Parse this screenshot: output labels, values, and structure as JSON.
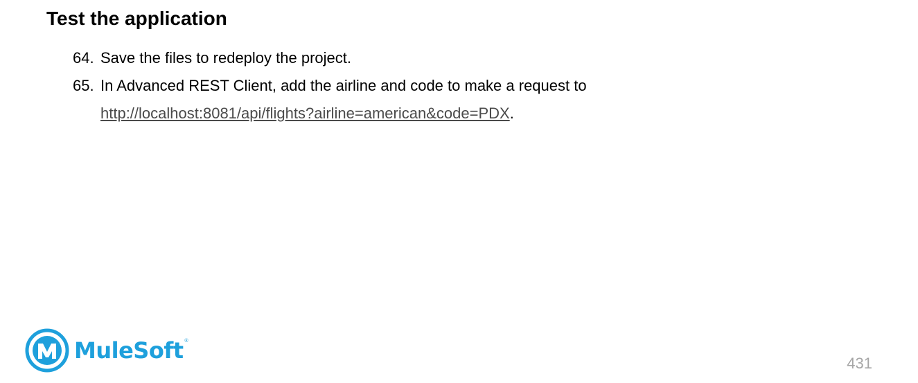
{
  "heading": "Test the application",
  "steps": [
    {
      "number": "64.",
      "text": "Save the files to redeploy the project."
    },
    {
      "number": "65.",
      "text": "In Advanced REST Client, add the airline and code to make a request to",
      "link": "http://localhost:8081/api/flights?airline=american&code=PDX",
      "after_link": "."
    }
  ],
  "footer": {
    "logo_text": "MuleSoft",
    "logo_mark": "®",
    "logo_icon": "mulesoft-logo-icon",
    "page_number": "431"
  },
  "colors": {
    "brand": "#1ea0dc",
    "link": "#4a4a4a",
    "page_number": "#a6a6a6"
  }
}
